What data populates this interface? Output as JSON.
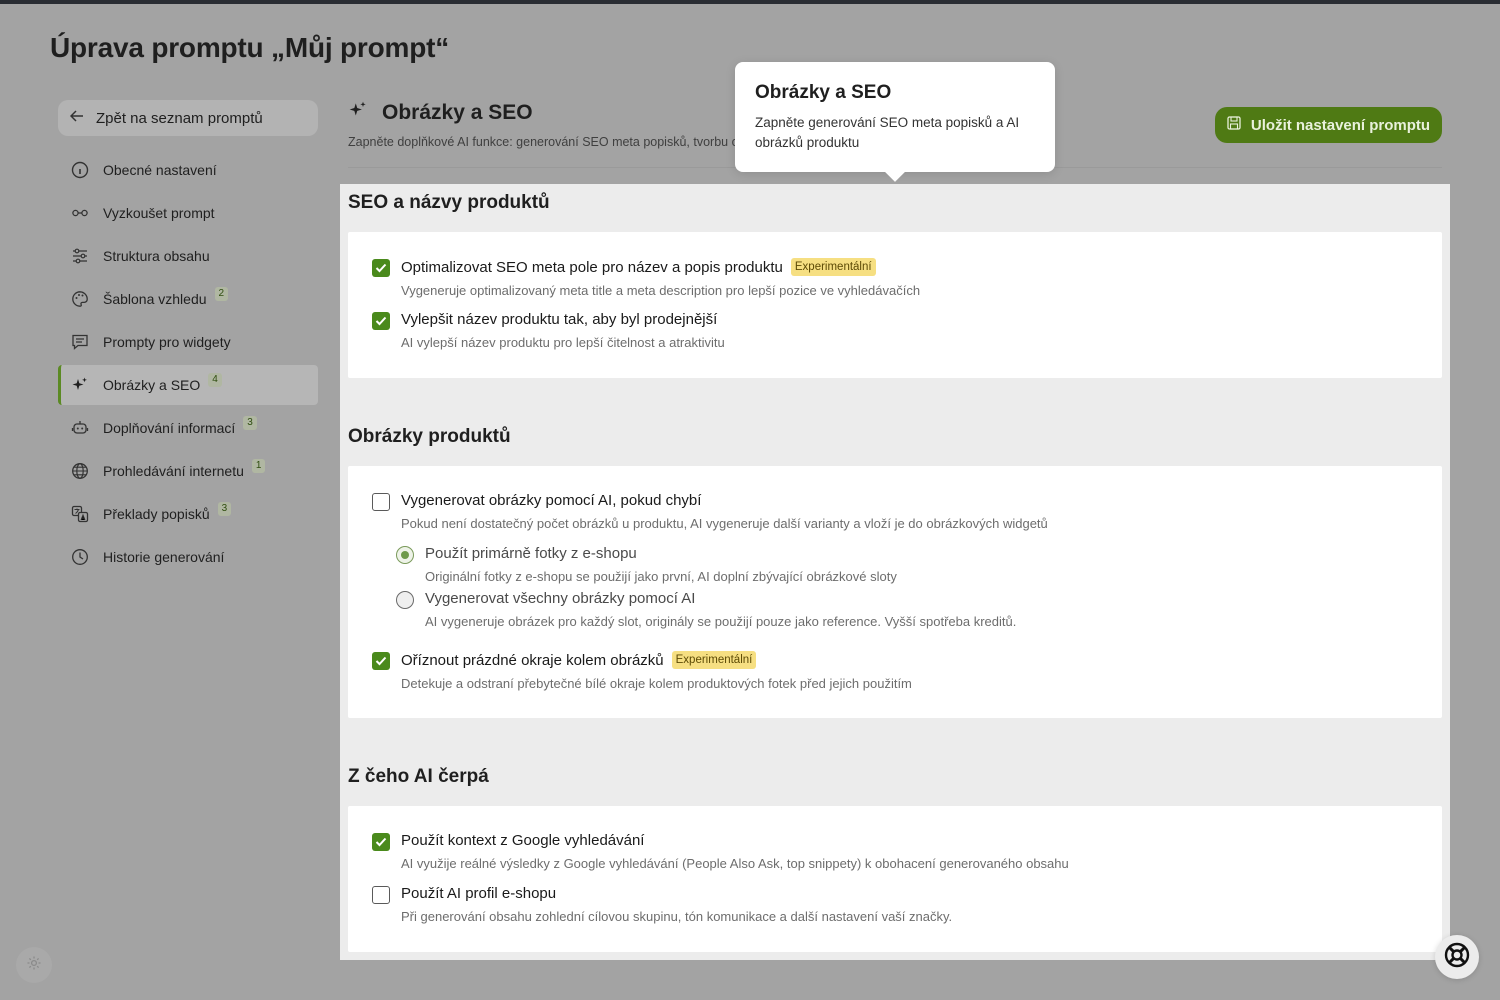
{
  "page": {
    "title": "Úprava promptu „Můj prompt“"
  },
  "sidebar": {
    "back_label": "Zpět na seznam promptů",
    "items": [
      {
        "label": "Obecné nastavení",
        "icon": "info-icon",
        "badge": ""
      },
      {
        "label": "Vyzkoušet prompt",
        "icon": "glasses-icon",
        "badge": ""
      },
      {
        "label": "Struktura obsahu",
        "icon": "sliders-icon",
        "badge": ""
      },
      {
        "label": "Šablona vzhledu",
        "icon": "palette-icon",
        "badge": "2"
      },
      {
        "label": "Prompty pro widgety",
        "icon": "chat-icon",
        "badge": ""
      },
      {
        "label": "Obrázky a SEO",
        "icon": "sparkles-icon",
        "badge": "4",
        "active": true
      },
      {
        "label": "Doplňování informací",
        "icon": "robot-icon",
        "badge": "3"
      },
      {
        "label": "Prohledávání internetu",
        "icon": "globe-icon",
        "badge": "1"
      },
      {
        "label": "Překlady popisků",
        "icon": "translate-icon",
        "badge": "3"
      },
      {
        "label": "Historie generování",
        "icon": "history-icon",
        "badge": ""
      }
    ]
  },
  "section": {
    "title": "Obrázky a SEO",
    "subtitle": "Zapněte doplňkové AI funkce: generování SEO meta popisků, tvorbu obrázků a další.",
    "save_label": "Uložit nastavení promptu"
  },
  "tooltip": {
    "title": "Obrázky a SEO",
    "text": "Zapněte generování SEO meta popisků a AI obrázků produktu"
  },
  "groups": {
    "seo": {
      "title": "SEO a názvy produktů",
      "options": [
        {
          "label": "Optimalizovat SEO meta pole pro název a popis produktu",
          "badge": "Experimentální",
          "desc": "Vygeneruje optimalizovaný meta title a meta description pro lepší pozice ve vyhledávačích",
          "checked": true
        },
        {
          "label": "Vylepšit název produktu tak, aby byl prodejnější",
          "desc": "AI vylepší název produktu pro lepší čitelnost a atraktivitu",
          "checked": true
        }
      ]
    },
    "images": {
      "title": "Obrázky produktů",
      "generate": {
        "label": "Vygenerovat obrázky pomocí AI, pokud chybí",
        "desc": "Pokud není dostatečný počet obrázků u produktu, AI vygeneruje další varianty a vloží je do obrázkových widgetů",
        "checked": false
      },
      "radio_primary": {
        "label": "Použít primárně fotky z e-shopu",
        "desc": "Originální fotky z e-shopu se použijí jako první, AI doplní zbývající obrázkové sloty",
        "selected": true
      },
      "radio_all": {
        "label": "Vygenerovat všechny obrázky pomocí AI",
        "desc": "AI vygeneruje obrázek pro každý slot, originály se použijí pouze jako reference. Vyšší spotřeba kreditů.",
        "selected": false
      },
      "trim": {
        "label": "Oříznout prázdné okraje kolem obrázků",
        "badge": "Experimentální",
        "desc": "Detekuje a odstraní přebytečné bílé okraje kolem produktových fotek před jejich použitím",
        "checked": true
      }
    },
    "sources": {
      "title": "Z čeho AI čerpá",
      "options": [
        {
          "label": "Použít kontext z Google vyhledávání",
          "desc": "AI využije reálné výsledky z Google vyhledávání (People Also Ask, top snippety) k obohacení generovaného obsahu",
          "checked": true
        },
        {
          "label": "Použít AI profil e-shopu",
          "desc": "Při generování obsahu zohlední cílovou skupinu, tón komunikace a další nastavení vaší značky.",
          "checked": false
        }
      ]
    }
  },
  "colors": {
    "accent": "#4a8a1c",
    "save_button": "#4f7a14",
    "experimental_badge": "#f6df82"
  }
}
